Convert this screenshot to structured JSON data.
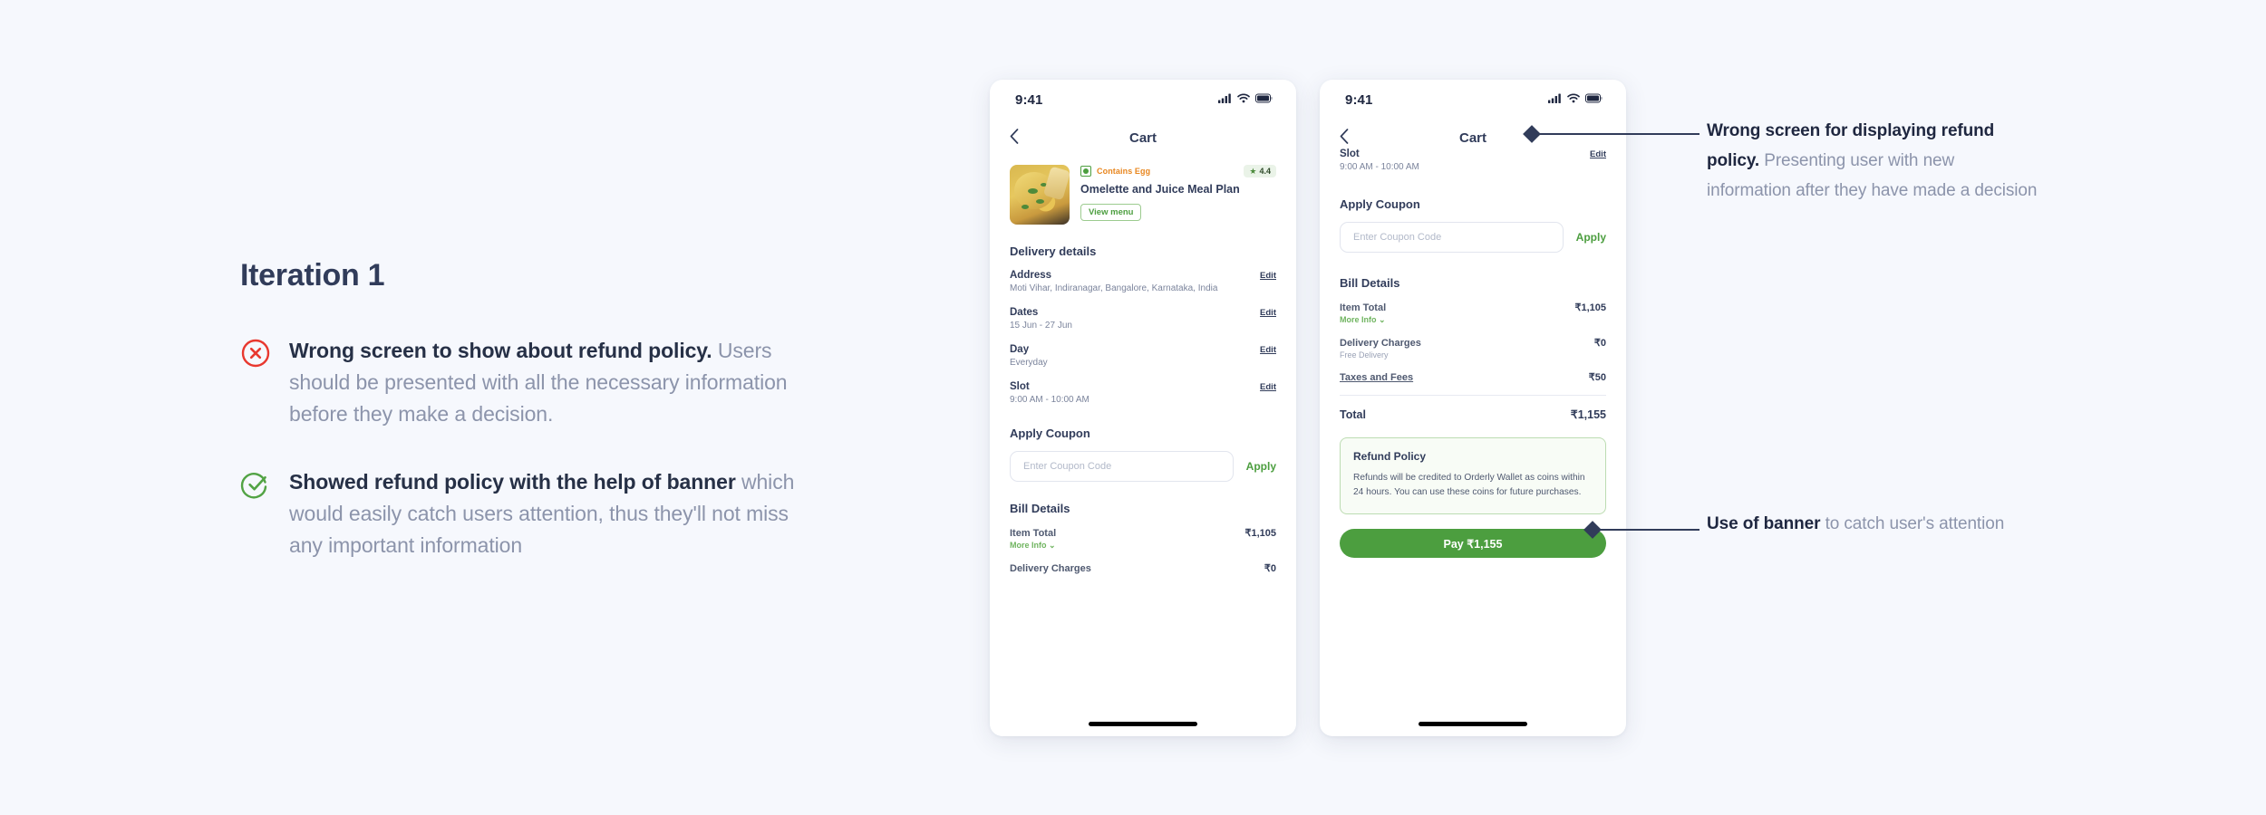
{
  "theme": {
    "background": "#f6f8fd",
    "accent_green": "#4c9e3f",
    "text_dark": "#313c5a",
    "text_muted": "#8c94ab",
    "error_red": "#e63946",
    "orange": "#e8861e"
  },
  "commentary": {
    "title": "Iteration 1",
    "points": [
      {
        "icon": "error-circle-icon",
        "bold": "Wrong screen to show about refund policy.",
        "rest": " Users should be presented with all the necessary information before they make a decision."
      },
      {
        "icon": "check-circle-icon",
        "bold": "Showed refund policy with the help of banner",
        "rest": " which would easily catch users attention, thus they'll not miss any important information"
      }
    ]
  },
  "phone1": {
    "status": {
      "time": "9:41",
      "signal": "cellular-signal-icon",
      "wifi": "wifi-icon",
      "battery": "battery-icon"
    },
    "nav": {
      "back": "chevron-left-icon",
      "title": "Cart"
    },
    "item": {
      "thumb": "omelette-photo",
      "diet_mark": "egg-indicator-icon",
      "diet_label": "Contains Egg",
      "rating_star": "star-icon",
      "rating": "4.4",
      "name": "Omelette and Juice Meal Plan",
      "view_menu": "View menu"
    },
    "delivery": {
      "heading": "Delivery details",
      "edit_label": "Edit",
      "rows": [
        {
          "label": "Address",
          "value": "Moti Vihar, Indiranagar, Bangalore, Karnataka, India"
        },
        {
          "label": "Dates",
          "value": "15 Jun - 27 Jun"
        },
        {
          "label": "Day",
          "value": "Everyday"
        },
        {
          "label": "Slot",
          "value": "9:00 AM - 10:00 AM"
        }
      ]
    },
    "coupon": {
      "heading": "Apply Coupon",
      "placeholder": "Enter Coupon Code",
      "value": "",
      "apply_label": "Apply"
    },
    "bill": {
      "heading": "Bill Details",
      "rows": [
        {
          "label": "Item Total",
          "amount": "₹1,105",
          "sub": "More Info",
          "sub_type": "link"
        },
        {
          "label": "Delivery Charges",
          "amount": "₹0",
          "sub": "",
          "sub_type": ""
        }
      ]
    },
    "home_indicator": "home-indicator"
  },
  "phone2": {
    "status": {
      "time": "9:41",
      "signal": "cellular-signal-icon",
      "wifi": "wifi-icon",
      "battery": "battery-icon"
    },
    "nav": {
      "back": "chevron-left-icon",
      "title": "Cart"
    },
    "slot": {
      "label": "Slot",
      "value": "9:00 AM - 10:00 AM",
      "edit_label": "Edit"
    },
    "coupon": {
      "heading": "Apply Coupon",
      "placeholder": "Enter Coupon Code",
      "value": "",
      "apply_label": "Apply"
    },
    "bill": {
      "heading": "Bill Details",
      "item_total_label": "Item Total",
      "item_total_amount": "₹1,105",
      "more_info": "More Info",
      "delivery_label": "Delivery Charges",
      "delivery_amount": "₹0",
      "delivery_sub": "Free Delivery",
      "taxes_label": "Taxes and Fees",
      "taxes_amount": "₹50",
      "total_label": "Total",
      "total_amount": "₹1,155"
    },
    "refund": {
      "title": "Refund Policy",
      "body": "Refunds will be credited to Orderly Wallet as coins within 24 hours. You can use these coins for future purchases."
    },
    "pay_button": "Pay ₹1,155",
    "home_indicator": "home-indicator"
  },
  "annotations": [
    {
      "bold": "Wrong screen for displaying refund policy.",
      "rest": " Presenting user with new information after they have made a decision"
    },
    {
      "bold": "Use of banner",
      "rest": " to catch user's attention"
    }
  ]
}
